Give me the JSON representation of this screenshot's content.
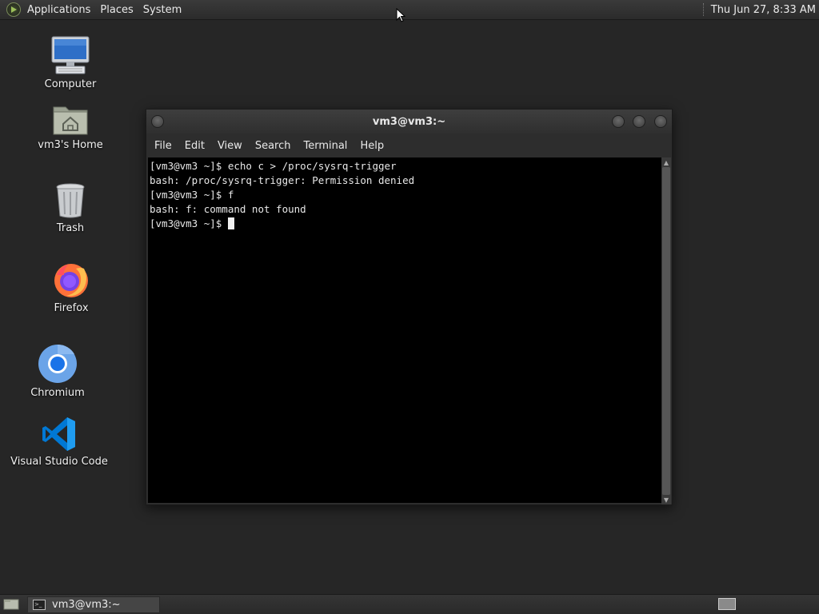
{
  "top_panel": {
    "menus": [
      "Applications",
      "Places",
      "System"
    ],
    "clock": "Thu Jun 27,  8:33 AM"
  },
  "desktop_icons": [
    {
      "label": "Computer",
      "icon": "computer-icon"
    },
    {
      "label": "vm3's Home",
      "icon": "home-folder-icon"
    },
    {
      "label": "Trash",
      "icon": "trash-icon"
    },
    {
      "label": "Firefox",
      "icon": "firefox-icon"
    },
    {
      "label": "Chromium",
      "icon": "chromium-icon"
    },
    {
      "label": "Visual Studio Code",
      "icon": "vscode-icon"
    }
  ],
  "terminal": {
    "title": "vm3@vm3:~",
    "menu": [
      "File",
      "Edit",
      "View",
      "Search",
      "Terminal",
      "Help"
    ],
    "lines": [
      "[vm3@vm3 ~]$ echo c > /proc/sysrq-trigger",
      "bash: /proc/sysrq-trigger: Permission denied",
      "[vm3@vm3 ~]$ f",
      "bash: f: command not found",
      "[vm3@vm3 ~]$ "
    ]
  },
  "bottom_panel": {
    "task_label": "vm3@vm3:~"
  }
}
